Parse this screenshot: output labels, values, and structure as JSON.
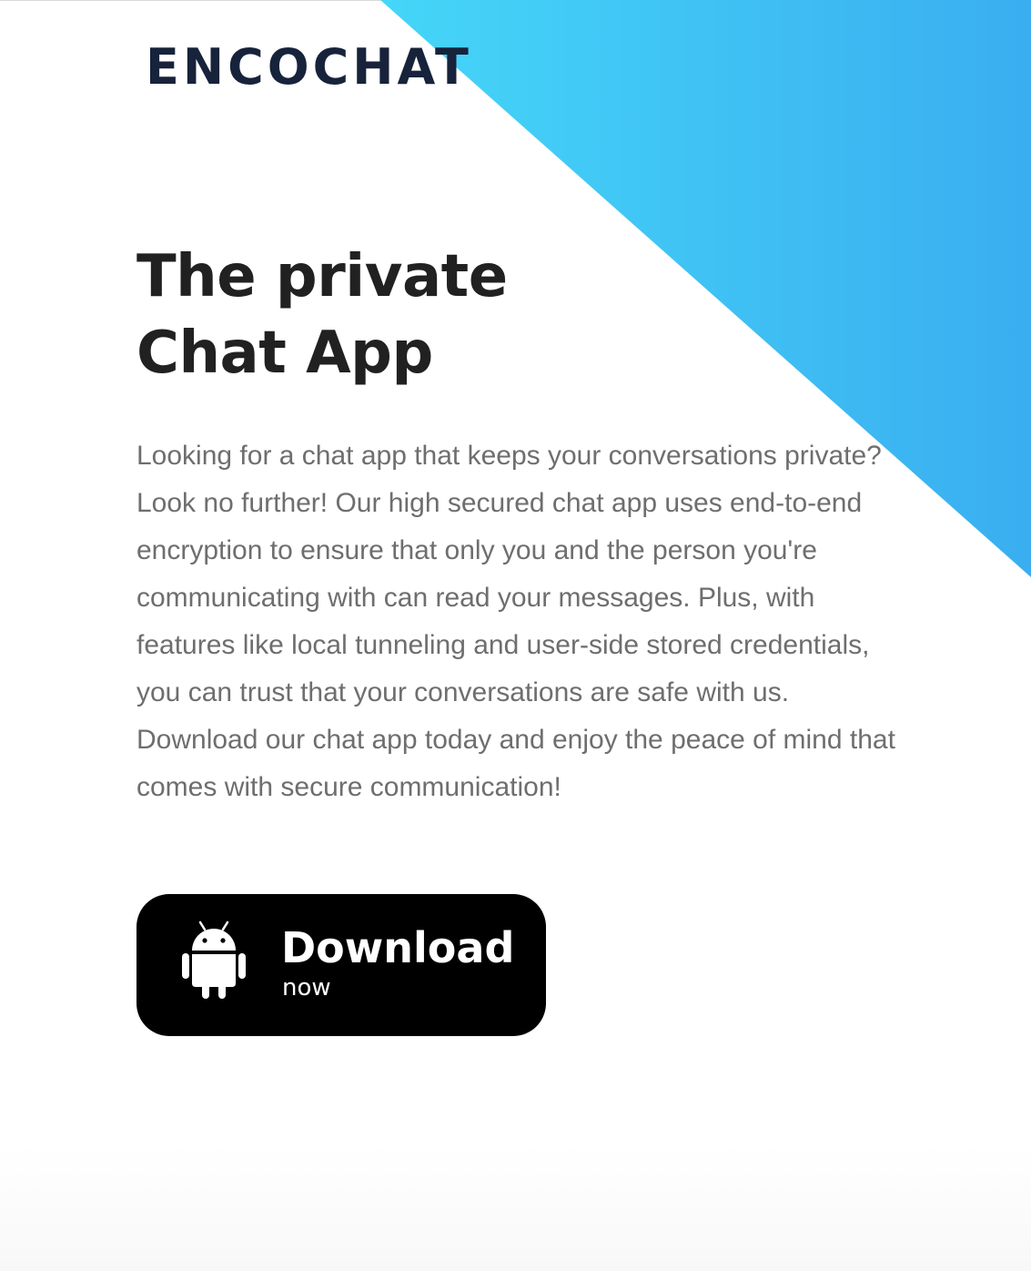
{
  "brand": {
    "logo_text": "ENCOCHAT",
    "accent_gradient": [
      "#45d6f8",
      "#3aaef0"
    ],
    "text_color": "#17233b"
  },
  "hero": {
    "headline_line1": "The private",
    "headline_line2": "Chat App",
    "description": "Looking for a chat app that keeps your conversations private?\nLook no further! Our high secured chat app uses end-to-end\nencryption to ensure that only you and the person you're\ncommunicating with can read your messages. Plus, with\nfeatures like local tunneling and user-side stored credentials,\nyou can trust that your conversations are safe with us.\nDownload our chat app today and enjoy the peace of mind that\ncomes with secure communication!"
  },
  "download_button": {
    "title": "Download",
    "subtitle": "now",
    "icon": "android-icon",
    "background": "#000000"
  }
}
